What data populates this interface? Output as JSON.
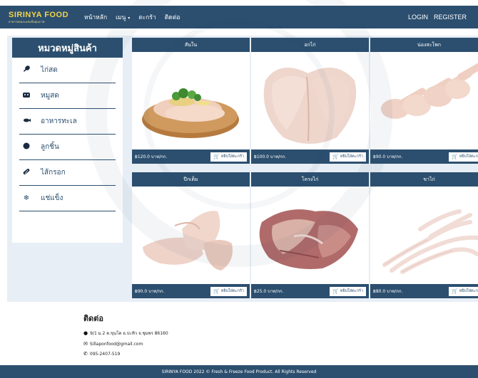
{
  "navbar": {
    "brand_name": "SIRINYA FOOD",
    "brand_tagline": "อาหารสดและแช่แข็งคุณภาพ",
    "links": [
      {
        "label": "หน้าหลัก"
      },
      {
        "label": "เมนู",
        "has_dropdown": true
      },
      {
        "label": "ตะกร้า"
      },
      {
        "label": "ติดต่อ"
      }
    ],
    "login_label": "LOGIN",
    "register_label": "REGISTER"
  },
  "sidebar": {
    "title": "หมวดหมู่สินค้า",
    "items": [
      {
        "label": "ไก่สด",
        "icon": "drumstick-icon",
        "glyph": "🍗"
      },
      {
        "label": "หมูสด",
        "icon": "pig-icon",
        "glyph": "🐖"
      },
      {
        "label": "อาหารทะเล",
        "icon": "fish-icon",
        "glyph": "🐟"
      },
      {
        "label": "ลูกชิ้น",
        "icon": "ball-icon",
        "glyph": "●"
      },
      {
        "label": "ไส้กรอก",
        "icon": "sausage-icon",
        "glyph": "≋"
      },
      {
        "label": "แช่แข็ง",
        "icon": "snowflake-icon",
        "glyph": "❄"
      }
    ]
  },
  "products": [
    {
      "title": "สันใน",
      "price": "฿120.0 บาท/กก.",
      "button": "หยิบใส่ตะกร้า",
      "image": "chicken-tenderloin"
    },
    {
      "title": "อกไก่",
      "price": "฿100.0 บาท/กก.",
      "button": "หยิบใส่ตะกร้า",
      "image": "chicken-breast"
    },
    {
      "title": "น่องสะโพก",
      "price": "฿90.0 บาท/กก.",
      "button": "หยิบใส่ตะกร้า",
      "image": "chicken-drumstick"
    },
    {
      "title": "ปีกเต็ม",
      "price": "฿90.0 บาท/กก.",
      "button": "หยิบใส่ตะกร้า",
      "image": "chicken-wing"
    },
    {
      "title": "โครงไก่",
      "price": "฿25.0 บาท/กก.",
      "button": "หยิบใส่ตะกร้า",
      "image": "chicken-carcass"
    },
    {
      "title": "ขาไก่",
      "price": "฿80.0 บาท/กก.",
      "button": "หยิบใส่ตะกร้า",
      "image": "chicken-feet"
    }
  ],
  "contact": {
    "title": "ติดต่อ",
    "address": "9/1 ม.2 ต.ขุนโต อ.ปะทิว จ.ชุมพร 86160",
    "email": "Sillaponfood@gmail.com",
    "phone": "095-2407-519"
  },
  "footer": {
    "text": "SIRINYA FOOD 2022 © Fresh & Freeze Food Product. All Rights Reserved"
  },
  "colors": {
    "primary": "#2c4f6f",
    "brand_yellow": "#f3d34a",
    "background": "#e8eef5"
  }
}
